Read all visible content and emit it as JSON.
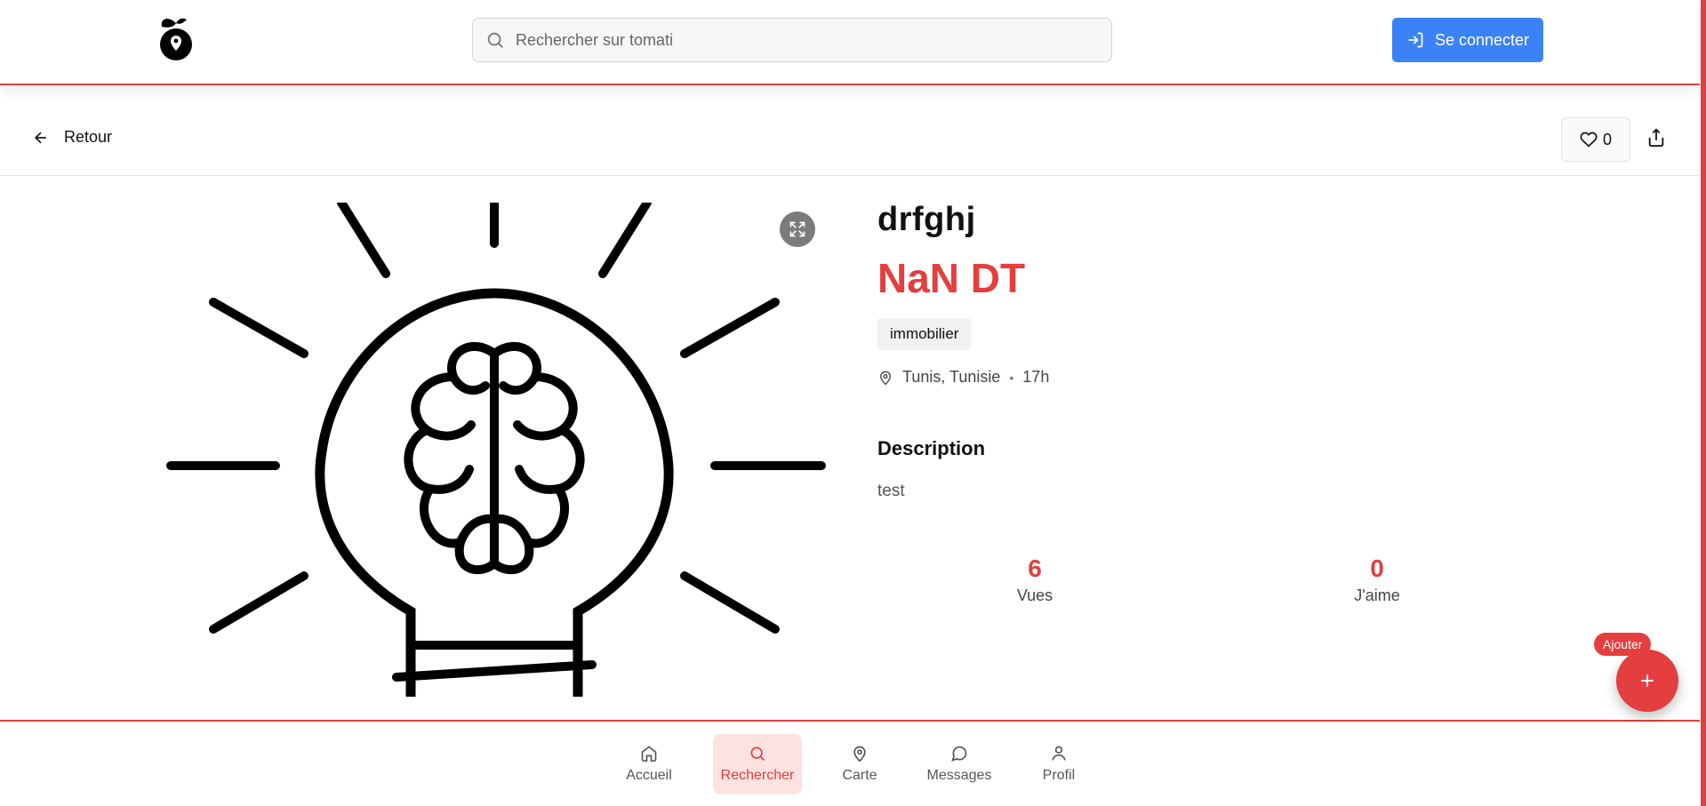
{
  "header": {
    "search_placeholder": "Rechercher sur tomati",
    "login_label": "Se connecter"
  },
  "subbar": {
    "back_label": "Retour",
    "like_count": "0"
  },
  "listing": {
    "title": "drfghj",
    "price": "NaN DT",
    "category": "immobilier",
    "location": "Tunis, Tunisie",
    "separator": "•",
    "time_ago": "17h",
    "description_heading": "Description",
    "description": "test",
    "stats": [
      {
        "value": "6",
        "label": "Vues"
      },
      {
        "value": "0",
        "label": "J'aime"
      }
    ]
  },
  "fab": {
    "label": "Ajouter"
  },
  "bottom_nav": [
    {
      "label": "Accueil",
      "icon": "home-icon"
    },
    {
      "label": "Rechercher",
      "icon": "search-icon",
      "active": true
    },
    {
      "label": "Carte",
      "icon": "map-pin-icon"
    },
    {
      "label": "Messages",
      "icon": "message-icon"
    },
    {
      "label": "Profil",
      "icon": "user-icon"
    }
  ],
  "colors": {
    "accent": "#e53e3e",
    "primary": "#3b82f6"
  }
}
